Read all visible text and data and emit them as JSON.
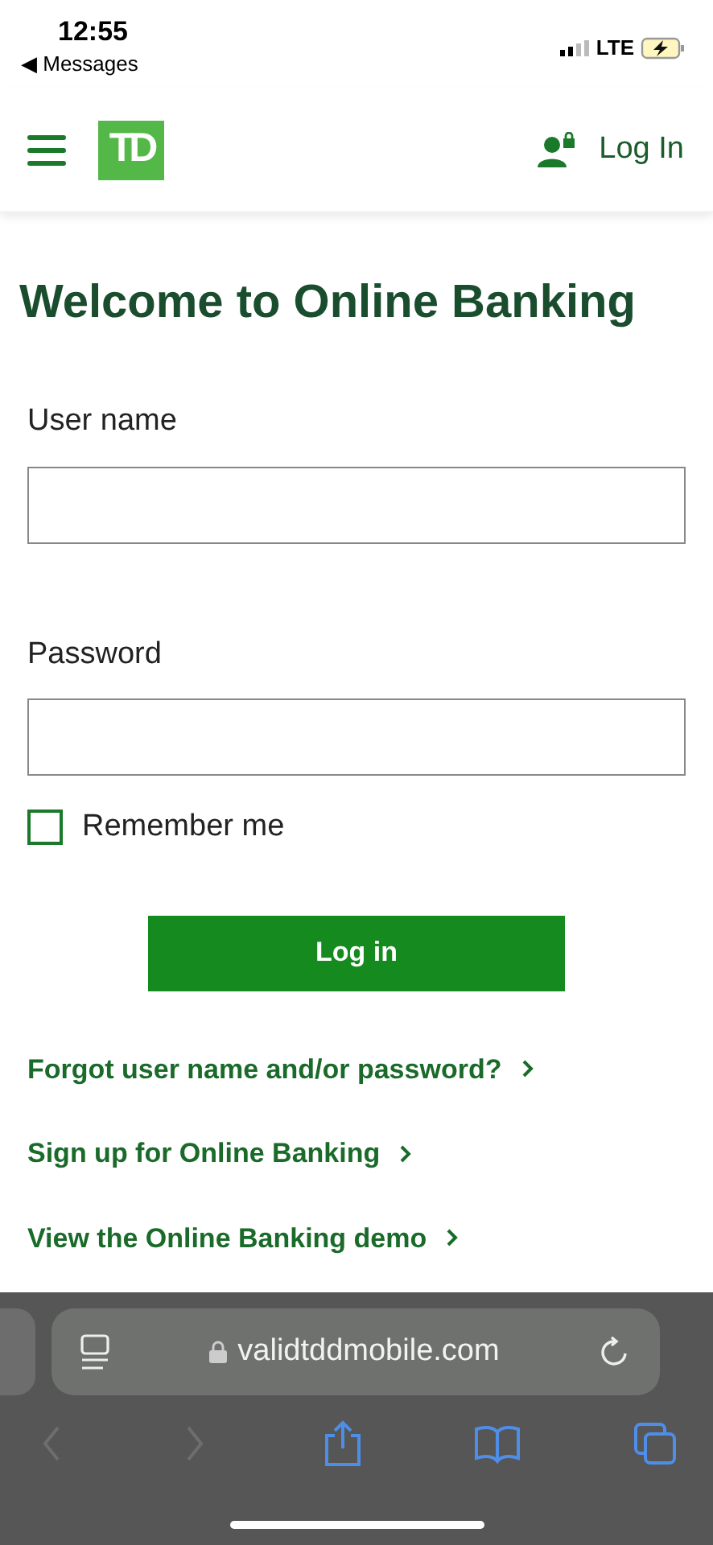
{
  "status_bar": {
    "time": "12:55",
    "back_label": "◀ Messages",
    "network": "LTE"
  },
  "header": {
    "logo": "TD",
    "login_link": "Log In"
  },
  "title": "Welcome to Online Banking",
  "fields": [
    {
      "label": "User name"
    },
    {
      "label": "Password"
    }
  ],
  "remember": {
    "label": "Remember me",
    "checked": false
  },
  "submit": "Log in",
  "links": [
    {
      "label": "Forgot user name and/or password?"
    },
    {
      "label": "Sign up for Online Banking"
    },
    {
      "label": "View the Online Banking demo"
    }
  ],
  "browser": {
    "url": "validtddmobile.com",
    "toolbar": [
      {
        "kind": "back",
        "disabled": true
      },
      {
        "kind": "forward",
        "disabled": true
      },
      {
        "kind": "share",
        "disabled": false
      },
      {
        "kind": "bookmarks",
        "disabled": false
      },
      {
        "kind": "tabs",
        "disabled": false
      }
    ]
  }
}
